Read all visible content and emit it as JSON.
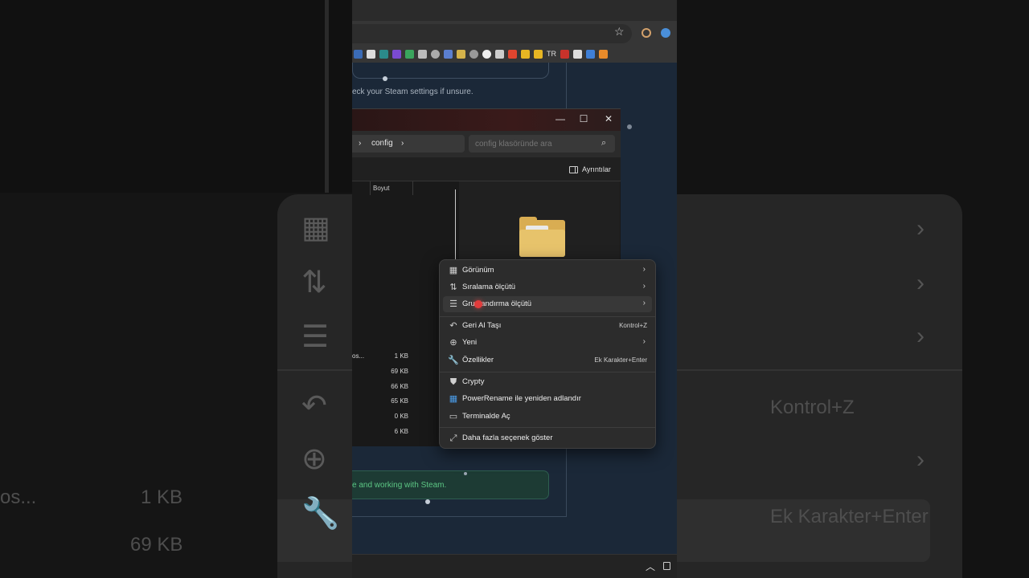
{
  "page": {
    "hint_text": "eck your Steam settings if unsure.",
    "success_text": "e and working with Steam."
  },
  "explorer": {
    "breadcrumb_current": "config",
    "search_placeholder": "config klasöründe ara",
    "details_label": "Ayrıntılar",
    "column_size": "Boyut",
    "files": [
      {
        "name": "os...",
        "size": "1 KB"
      },
      {
        "name": "",
        "size": "69 KB"
      },
      {
        "name": "",
        "size": "66 KB"
      },
      {
        "name": "",
        "size": "65 KB"
      },
      {
        "name": "",
        "size": "0 KB"
      },
      {
        "name": "",
        "size": "6 KB"
      }
    ]
  },
  "context_menu": {
    "items": [
      {
        "label": "Görünüm",
        "submenu": true
      },
      {
        "label": "Sıralama ölçütü",
        "submenu": true
      },
      {
        "label": "Gruplandırma ölçütü",
        "submenu": true,
        "highlighted": true
      },
      {
        "label": "Geri Al Taşı",
        "shortcut": "Kontrol+Z"
      },
      {
        "label": "Yeni",
        "submenu": true
      },
      {
        "label": "Özellikler",
        "shortcut": "Ek Karakter+Enter"
      },
      {
        "label": "Crypty"
      },
      {
        "label": "PowerRename ile yeniden adlandır"
      },
      {
        "label": "Terminalde Aç"
      },
      {
        "label": "Daha fazla seçenek göster"
      }
    ]
  },
  "background_zoom": {
    "undo_shortcut": "Kontrol+Z",
    "properties_shortcut": "Ek Karakter+Enter",
    "file_name": "os...",
    "size_1": "1 KB",
    "size_2": "69 KB"
  },
  "bookmarks": {
    "tr_label": "TR"
  }
}
